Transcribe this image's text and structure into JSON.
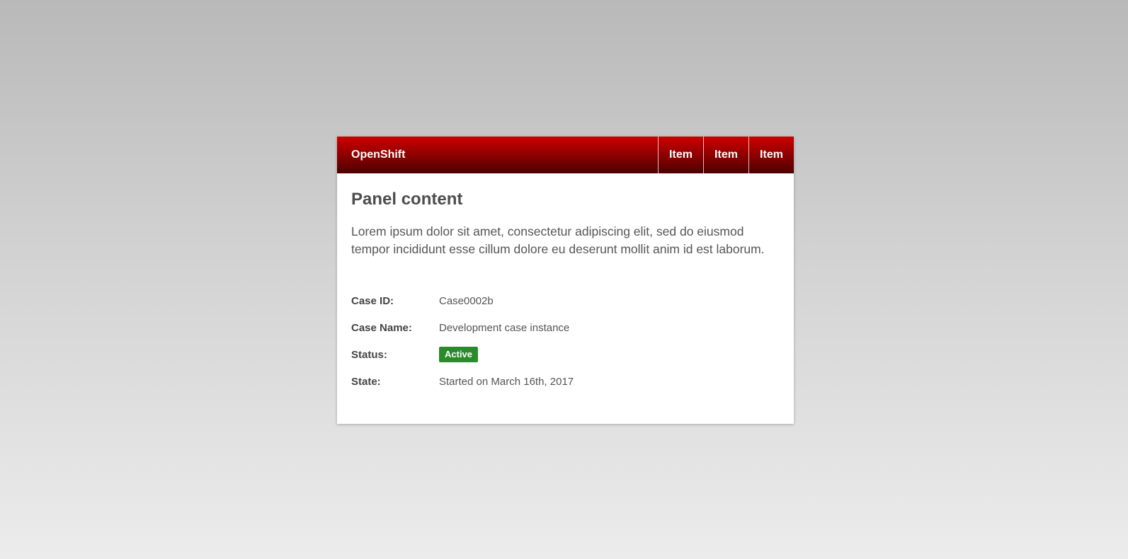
{
  "navbar": {
    "brand": "OpenShift",
    "items": [
      {
        "label": "Item"
      },
      {
        "label": "Item"
      },
      {
        "label": "Item"
      }
    ]
  },
  "panel": {
    "title": "Panel content",
    "text": "Lorem ipsum dolor sit amet, consectetur adipiscing elit, sed do eiusmod tempor incididunt esse cillum dolore eu deserunt mollit anim id est laborum."
  },
  "details": {
    "case_id": {
      "label": "Case ID:",
      "value": "Case0002b"
    },
    "case_name": {
      "label": "Case Name:",
      "value": "Development case instance"
    },
    "status": {
      "label": "Status:",
      "value": "Active",
      "color": "#2b8a2b"
    },
    "state": {
      "label": "State:",
      "value": "Started on March 16th, 2017"
    }
  },
  "colors": {
    "navbar_top": "#cc0000",
    "navbar_bottom": "#4a0000",
    "status_active": "#2b8a2b"
  }
}
